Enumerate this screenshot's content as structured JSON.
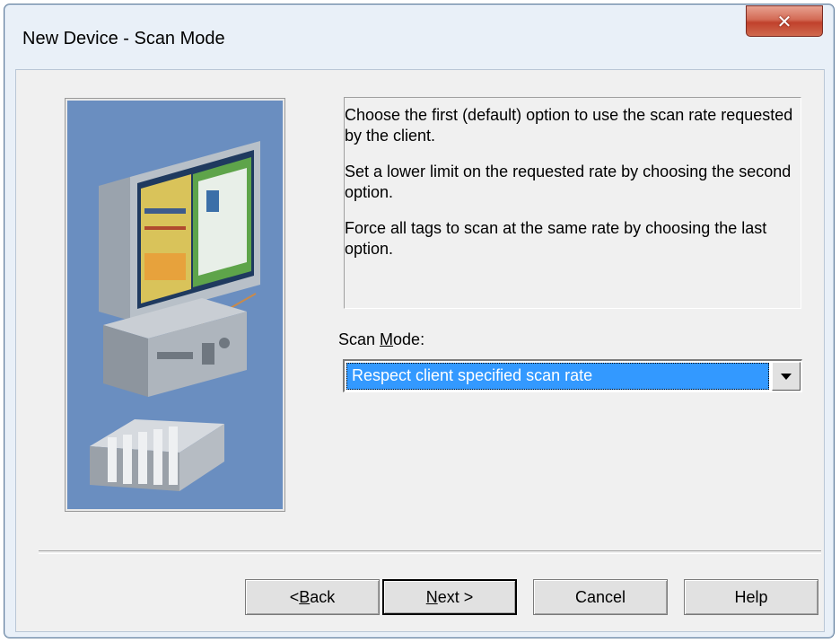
{
  "window": {
    "title": "New Device - Scan Mode"
  },
  "description": {
    "paragraphs": [
      "Choose the first (default) option to use the scan rate requested by the client.",
      "Set a lower limit on the requested rate by choosing the second option.",
      "Force all tags to scan at the same rate by choosing the last option."
    ]
  },
  "scan_mode": {
    "label_prefix": "Scan ",
    "label_accel": "M",
    "label_suffix": "ode:",
    "selected_value": "Respect client specified scan rate"
  },
  "buttons": {
    "back_prefix": "< ",
    "back_accel": "B",
    "back_suffix": "ack",
    "next_accel": "N",
    "next_suffix": "ext >",
    "cancel": "Cancel",
    "help": "Help"
  },
  "colors": {
    "illustration_bg": "#6a8ec0",
    "selection": "#3399ff",
    "close_button": "#c7503a"
  }
}
